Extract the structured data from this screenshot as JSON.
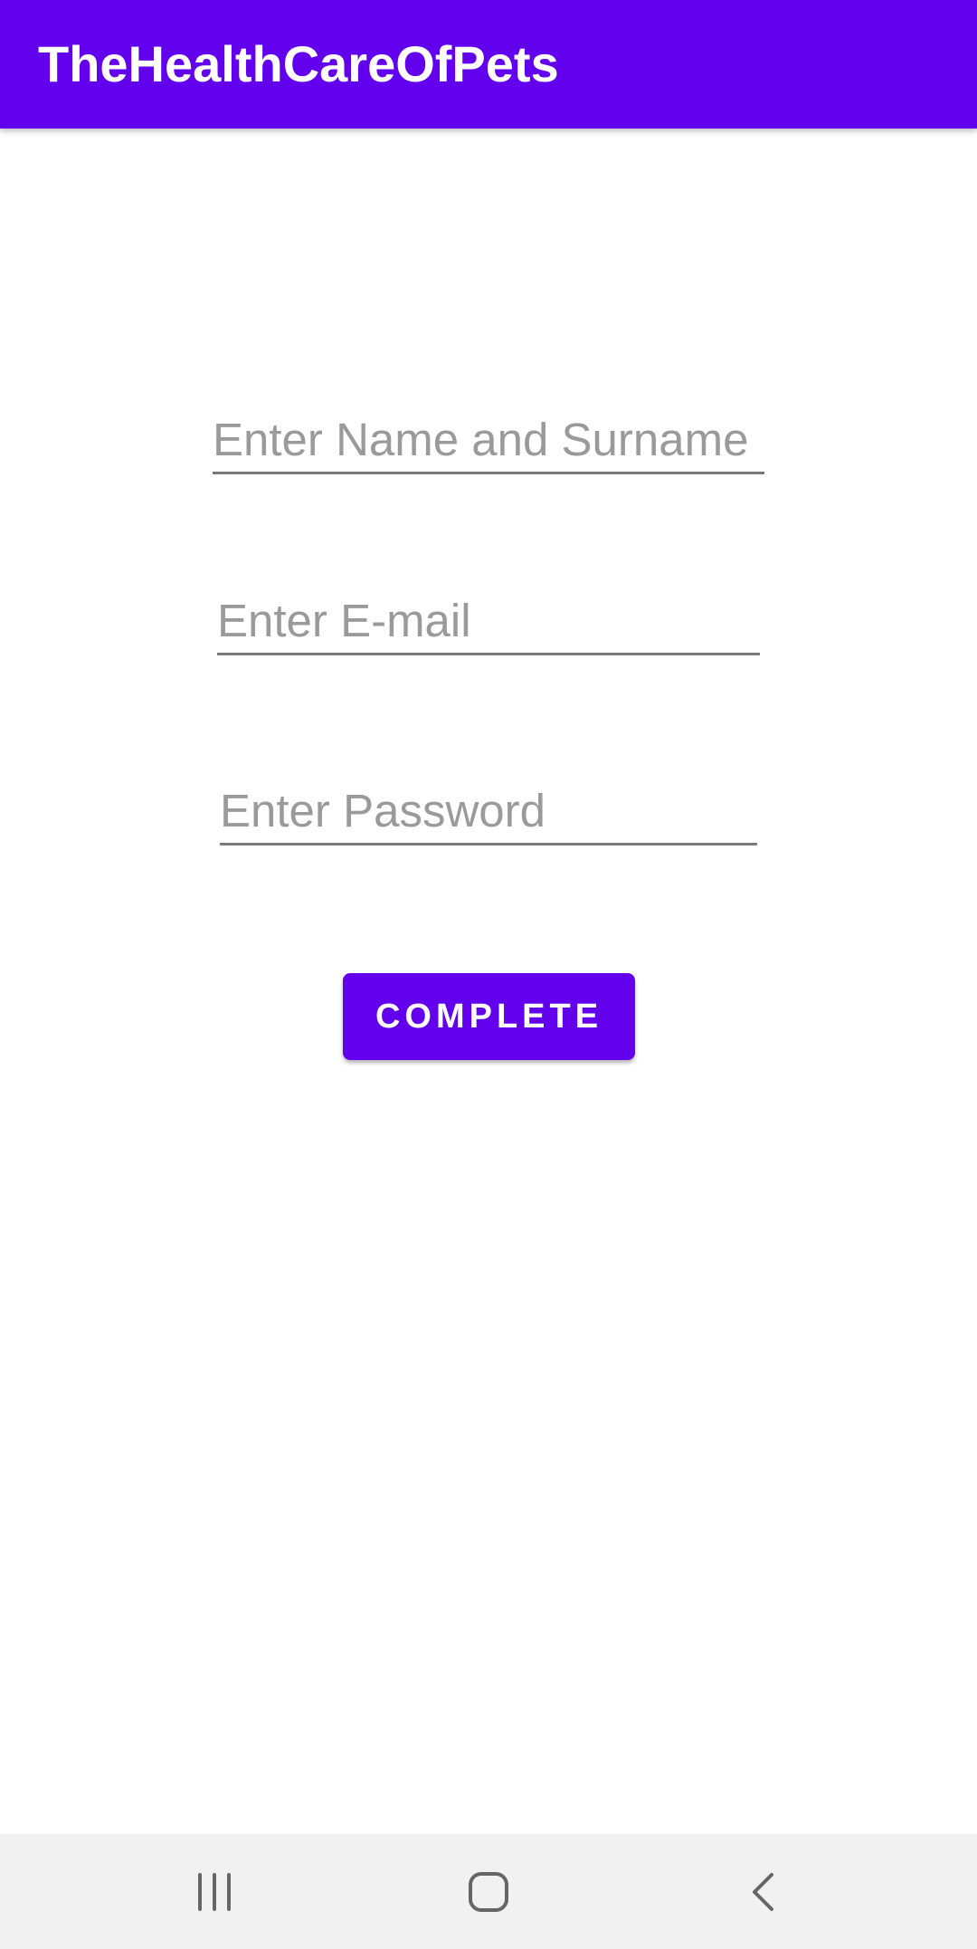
{
  "app_bar": {
    "title": "TheHealthCareOfPets",
    "color": "#6200ee"
  },
  "form": {
    "name_field": {
      "placeholder": "Enter Name and Surname",
      "value": ""
    },
    "email_field": {
      "placeholder": "Enter E-mail",
      "value": ""
    },
    "password_field": {
      "placeholder": "Enter Password",
      "value": ""
    },
    "complete_button": {
      "label": "COMPLETE",
      "color": "#6200ee"
    }
  },
  "nav_bar": {
    "buttons": [
      {
        "icon": "recents-icon"
      },
      {
        "icon": "home-icon"
      },
      {
        "icon": "back-icon"
      }
    ]
  }
}
